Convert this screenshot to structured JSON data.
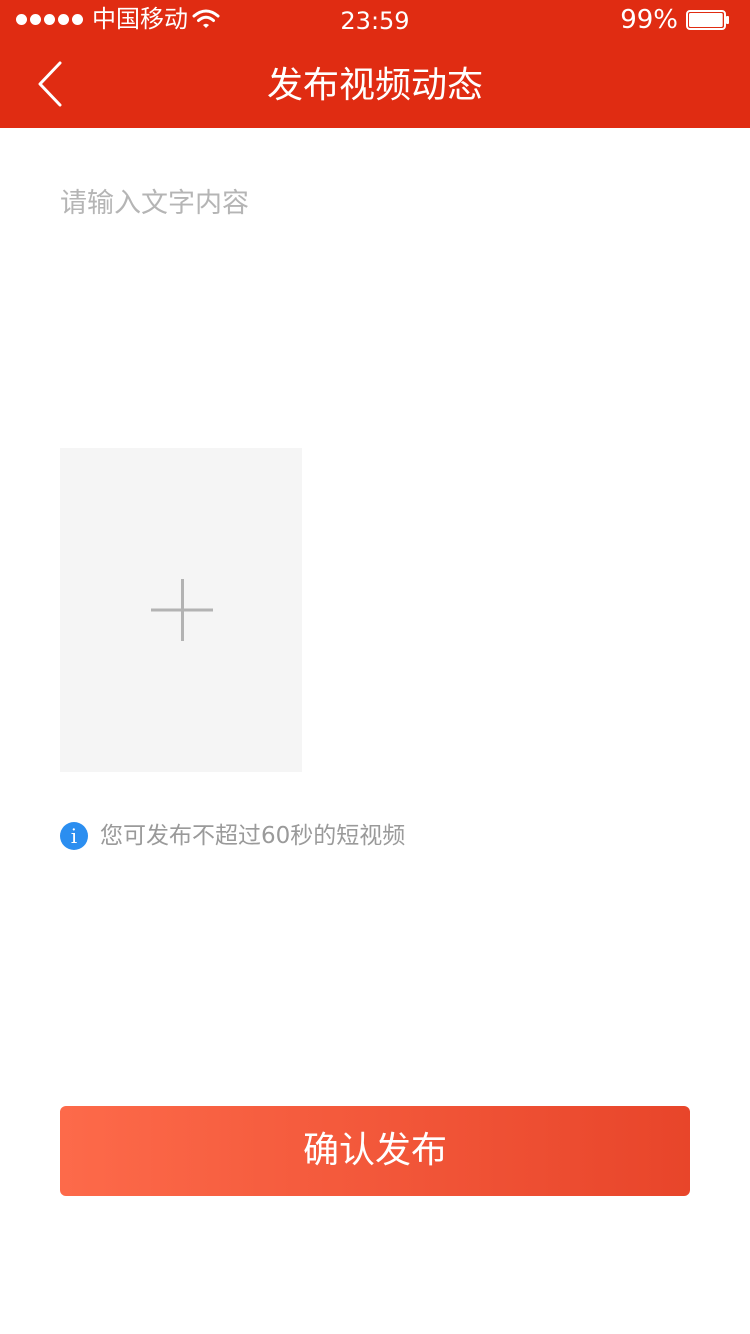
{
  "status_bar": {
    "carrier": "中国移动",
    "time": "23:59",
    "battery_percent": "99%",
    "battery_level": 0.99,
    "signal_bars": 5
  },
  "nav": {
    "title": "发布视频动态",
    "back_icon": "chevron-left-icon"
  },
  "form": {
    "text_placeholder": "请输入文字内容",
    "text_value": "",
    "upload_icon": "plus-icon",
    "tip_icon": "info-icon",
    "tip_text": "您可发布不超过60秒的短视频"
  },
  "actions": {
    "confirm_label": "确认发布"
  },
  "colors": {
    "header_bg": "#e02c12",
    "button_gradient_start": "#fd6a4a",
    "button_gradient_end": "#e8452a",
    "info_blue": "#2b8ef0",
    "upload_box_bg": "#f5f5f5"
  }
}
